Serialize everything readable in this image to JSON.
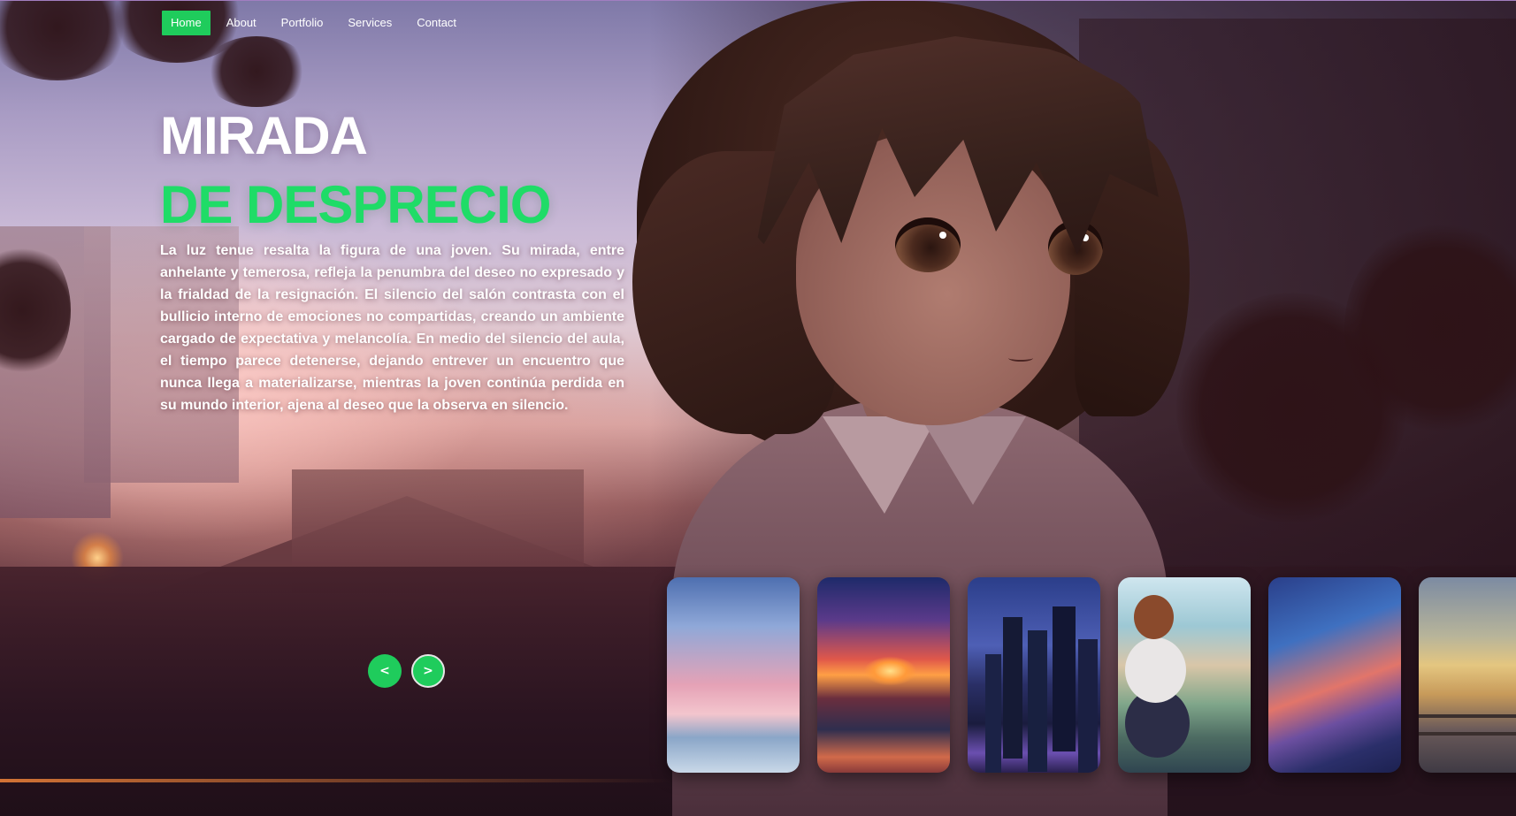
{
  "nav": {
    "items": [
      {
        "label": "Home",
        "active": true
      },
      {
        "label": "About",
        "active": false
      },
      {
        "label": "Portfolio",
        "active": false
      },
      {
        "label": "Services",
        "active": false
      },
      {
        "label": "Contact",
        "active": false
      }
    ]
  },
  "hero": {
    "title": "MIRADA",
    "subtitle": "DE DESPRECIO",
    "description": "La luz tenue resalta la figura de una joven. Su mirada, entre anhelante y temerosa, refleja la penumbra del deseo no expresado y la frialdad de la resignación. El silencio del salón contrasta con el bullicio interno de emociones no compartidas, creando un ambiente cargado de expectativa y melancolía. En medio del silencio del aula, el tiempo parece detenerse, dejando entrever un encuentro que nunca llega a materializarse, mientras la joven continúa perdida en su mundo interior, ajena al deseo que la observa en silencio."
  },
  "slider": {
    "prev_label": "<",
    "next_label": ">",
    "thumbnail_count": 6
  },
  "colors": {
    "accent": "#1fcc5c",
    "subtitle": "#1fdc67",
    "text": "#ffffff"
  }
}
